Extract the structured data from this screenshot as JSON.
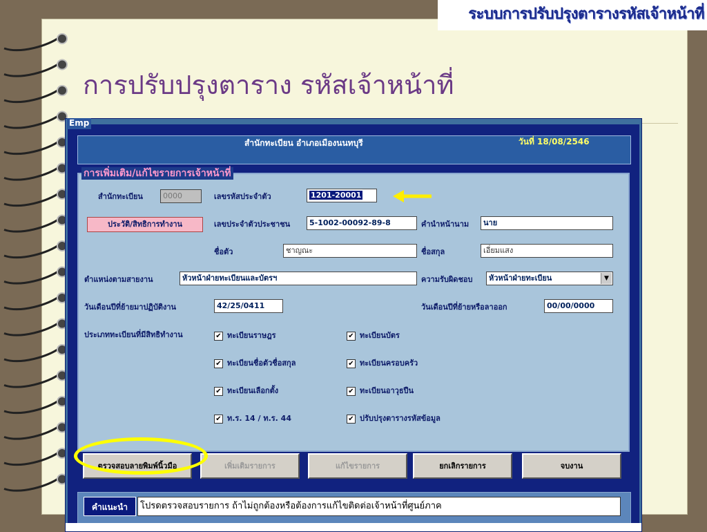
{
  "slide": {
    "banner_title": "ระบบการปรับปรุงตารางรหัสเจ้าหน้าที่",
    "title": "การปรับปรุงตาราง รหัสเจ้าหน้าที่"
  },
  "window": {
    "caption": "Emp",
    "office_name": "สำนักทะเบียน อำเภอเมืองนนทบุรี",
    "date": "วันที่ 18/08/2546"
  },
  "form": {
    "group_title": "การเพิ่มเติม/แก้ไขรายการเจ้าหน้าที่",
    "registry_office_label": "สำนักทะเบียน",
    "registry_office_value": "0000",
    "id_label": "เลขรหัสประจำตัว",
    "id_value": "1201-20001",
    "history_button": "ประวัติ/สิทธิการทำงาน",
    "citizen_id_label": "เลขประจำตัวประชาชน",
    "citizen_id_value": "5-1002-00092-89-8",
    "prefix_label": "คำนำหน้านาม",
    "prefix_value": "นาย",
    "firstname_label": "ชื่อตัว",
    "firstname_value": "ชาญณะ",
    "lastname_label": "ชื่อสกุล",
    "lastname_value": "เอี่ยมแสง",
    "position_label": "ตำแหน่งตามสายงาน",
    "position_value": "หัวหน้าฝ่ายทะเบียนและบัตรฯ",
    "responsibility_label": "ความรับผิดชอบ",
    "responsibility_value": "หัวหน้าฝ่ายทะเบียน",
    "start_date_label": "วันเดือนปีที่ย้ายมาปฏิบัติงาน",
    "start_date_value": "42/25/0411",
    "leave_date_label": "วันเดือนปีที่ย้ายหรือลาออก",
    "leave_date_value": "00/00/0000",
    "rights_label": "ประเภททะเบียนที่มีสิทธิทำงาน",
    "rights": [
      {
        "label": "ทะเบียนราษฎร",
        "checked": true
      },
      {
        "label": "ทะเบียนบัตร",
        "checked": true
      },
      {
        "label": "ทะเบียนชื่อตัวชื่อสกุล",
        "checked": true
      },
      {
        "label": "ทะเบียนครอบครัว",
        "checked": true
      },
      {
        "label": "ทะเบียนเลือกตั้ง",
        "checked": true
      },
      {
        "label": "ทะเบียนอาวุธปืน",
        "checked": true
      },
      {
        "label": "ท.ร. 14 / ท.ร. 44",
        "checked": true
      },
      {
        "label": "ปรับปรุงตารางรหัสข้อมูล",
        "checked": true
      }
    ],
    "checkmark": "✔"
  },
  "buttons": {
    "verify": "ตรวจสอบลายพิมพ์นิ้วมือ",
    "add": "เพิ่มเติมรายการ",
    "edit": "แก้ไขรายการ",
    "cancel": "ยกเลิกรายการ",
    "finish": "จบงาน"
  },
  "hint": {
    "label": "คำแนะนำ",
    "text": "โปรดตรวจสอบรายการ ถ้าไม่ถูกต้องหรือต้องการแก้ไขติดต่อเจ้าหน้าที่ศูนย์ภาค"
  },
  "colors": {
    "title": "#6b3a86",
    "banner": "#1a2a8c",
    "highlight": "#ffff00",
    "window_bg": "#11227f"
  }
}
